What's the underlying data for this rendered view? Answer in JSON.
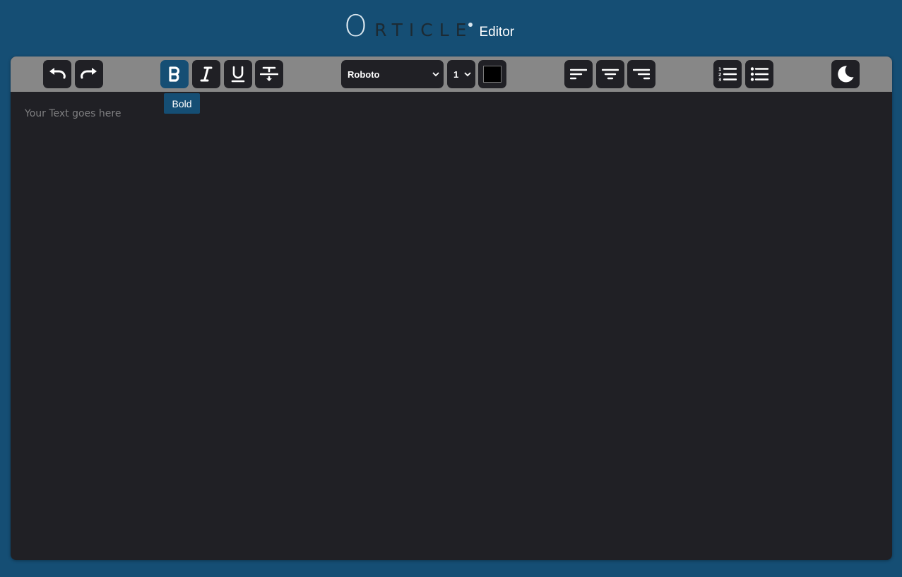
{
  "header": {
    "logo_initial": "O",
    "logo_rest": "RTICLE",
    "subtitle": "Editor"
  },
  "toolbar": {
    "undo_icon": "undo-icon",
    "redo_icon": "redo-icon",
    "bold_icon": "bold-icon",
    "italic_icon": "italic-icon",
    "underline_icon": "underline-icon",
    "strikethrough_icon": "strikethrough-icon",
    "font_family": "Roboto",
    "font_size": "1",
    "text_color": "#000000",
    "align_left_icon": "align-left-icon",
    "align_center_icon": "align-center-icon",
    "align_right_icon": "align-right-icon",
    "ordered_list_icon": "ordered-list-icon",
    "unordered_list_icon": "unordered-list-icon",
    "theme_toggle_icon": "moon-icon",
    "active_button": "bold"
  },
  "tooltip": {
    "text": "Bold"
  },
  "editor": {
    "placeholder": "Your Text goes here"
  },
  "colors": {
    "page_background": "#154e74",
    "toolbar_background": "#878787",
    "button_background": "#202025",
    "active_button": "#154e74",
    "editor_background": "#202025"
  }
}
